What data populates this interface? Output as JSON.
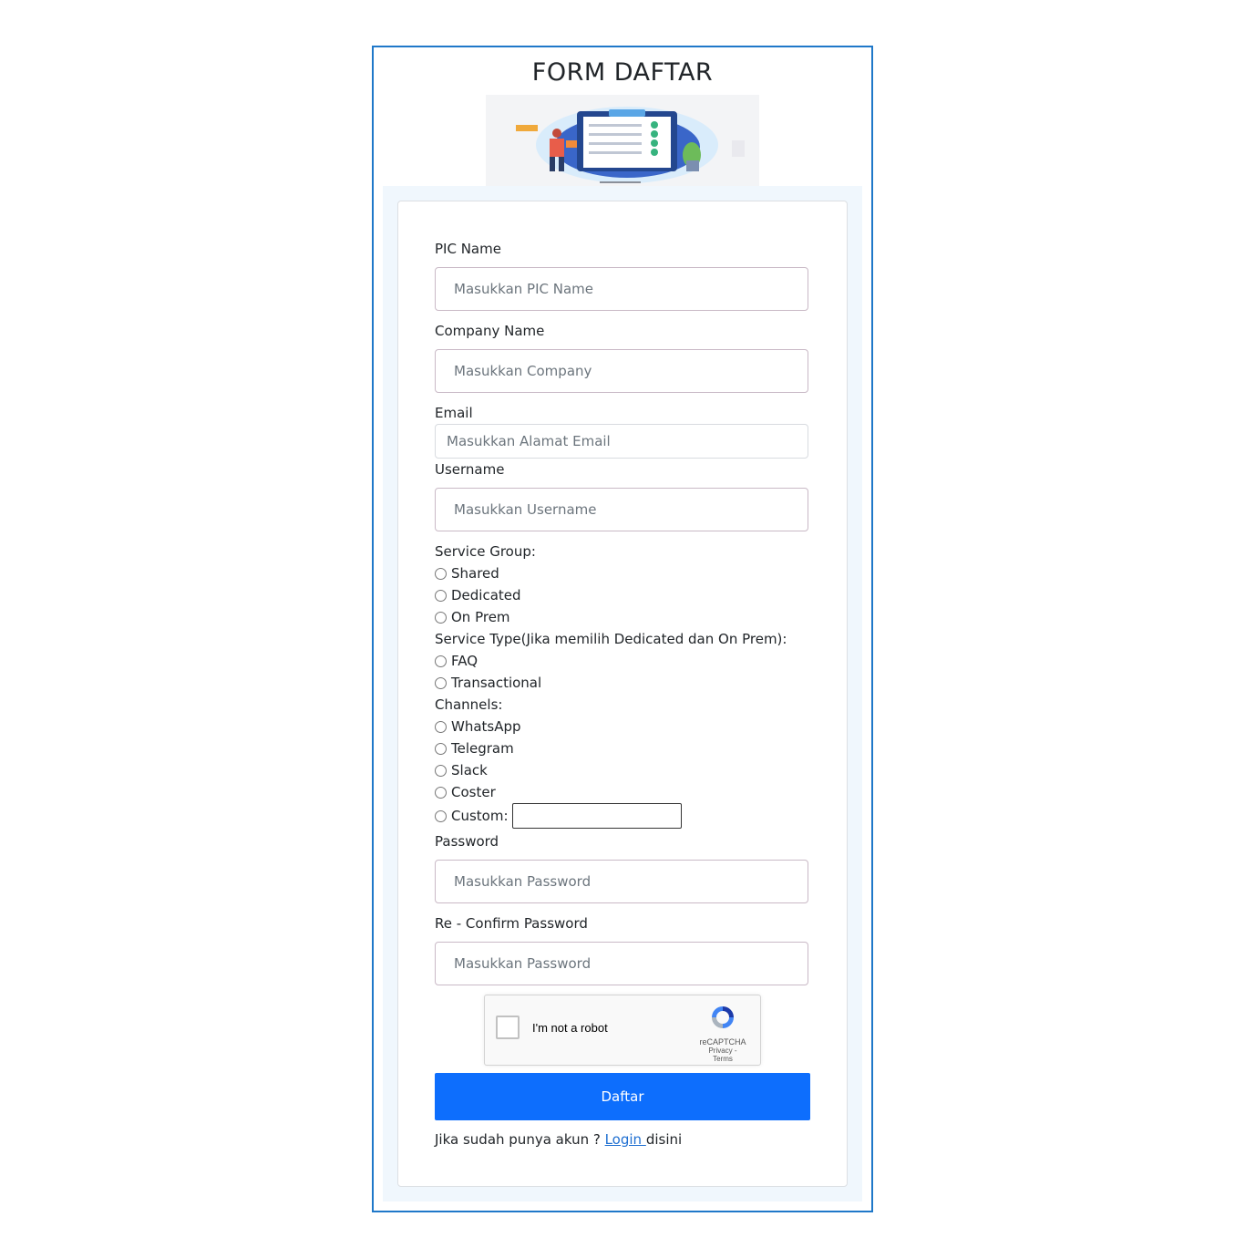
{
  "header": {
    "title": "FORM DAFTAR"
  },
  "form": {
    "pic_name": {
      "label": "PIC Name",
      "placeholder": "Masukkan PIC Name"
    },
    "company_name": {
      "label": "Company Name",
      "placeholder": "Masukkan Company"
    },
    "email": {
      "label": "Email",
      "placeholder": "Masukkan Alamat Email"
    },
    "username": {
      "label": "Username",
      "placeholder": "Masukkan Username"
    },
    "service_group": {
      "label": "Service Group:",
      "options": [
        "Shared",
        "Dedicated",
        "On Prem"
      ]
    },
    "service_type": {
      "label": "Service Type(Jika memilih Dedicated dan On Prem):",
      "options": [
        "FAQ",
        "Transactional"
      ]
    },
    "channels": {
      "label": "Channels:",
      "options": [
        "WhatsApp",
        "Telegram",
        "Slack",
        "Coster"
      ],
      "custom_label": "Custom:"
    },
    "password": {
      "label": "Password",
      "placeholder": "Masukkan Password"
    },
    "confirm_password": {
      "label": "Re - Confirm Password",
      "placeholder": "Masukkan Password"
    },
    "captcha": {
      "text": "I'm not a robot",
      "brand": "reCAPTCHA",
      "links": "Privacy - Terms"
    },
    "submit_label": "Daftar",
    "footer": {
      "prefix": "Jika sudah punya akun ? ",
      "link": "Login ",
      "suffix": "disini"
    }
  },
  "colors": {
    "primary": "#0d6efd",
    "border": "#1f78c9",
    "panel": "#f0f7fd"
  }
}
